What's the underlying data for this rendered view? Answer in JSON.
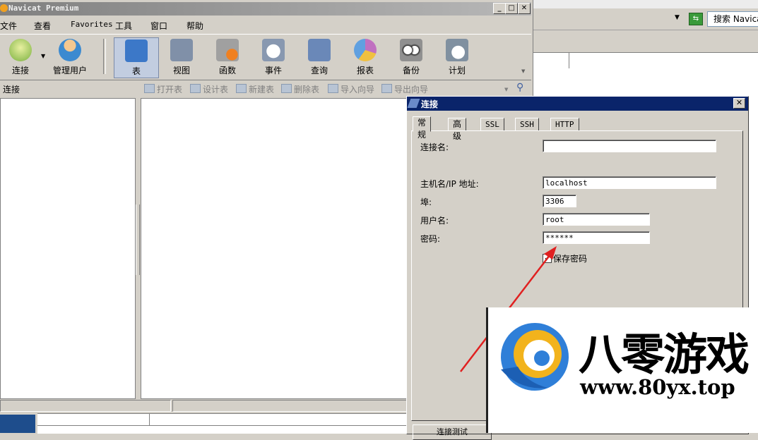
{
  "app": {
    "title": "Navicat Premium"
  },
  "menu": [
    "文件",
    "查看",
    "Favorites",
    "工具",
    "窗口",
    "帮助"
  ],
  "toolbar": {
    "connect": "连接",
    "manage_users": "管理用户",
    "items": [
      {
        "label": "表",
        "icon": "table-icon",
        "color": "#3c78c8"
      },
      {
        "label": "视图",
        "icon": "view-icon",
        "color": "#8090a8"
      },
      {
        "label": "函数",
        "icon": "function-icon",
        "color": "#a0a0a0"
      },
      {
        "label": "事件",
        "icon": "event-icon",
        "color": "#8898b0"
      },
      {
        "label": "查询",
        "icon": "query-icon",
        "color": "#6a88b8"
      },
      {
        "label": "报表",
        "icon": "report-icon",
        "color": "#c070c0"
      },
      {
        "label": "备份",
        "icon": "backup-icon",
        "color": "#909090"
      },
      {
        "label": "计划",
        "icon": "schedule-icon",
        "color": "#8090a0"
      }
    ]
  },
  "subbar": {
    "left_label": "连接",
    "actions": [
      "打开表",
      "设计表",
      "新建表",
      "删除表",
      "导入向导",
      "导出向导"
    ]
  },
  "search": {
    "label": "搜索 Navicat"
  },
  "dialog": {
    "title": "连接",
    "tabs": [
      "常规",
      "高级",
      "SSL",
      "SSH",
      "HTTP"
    ],
    "fields": {
      "conn_name_label": "连接名:",
      "conn_name_value": "",
      "host_label": "主机名/IP 地址:",
      "host_value": "localhost",
      "port_label": "埠:",
      "port_value": "3306",
      "user_label": "用户名:",
      "user_value": "root",
      "password_label": "密码:",
      "password_value": "******",
      "save_password_label": "保存密码",
      "save_password_checked": true
    },
    "bottom_button": "连接测试"
  },
  "watermark": {
    "name": "八零游戏",
    "url": "www.80yx.top"
  }
}
